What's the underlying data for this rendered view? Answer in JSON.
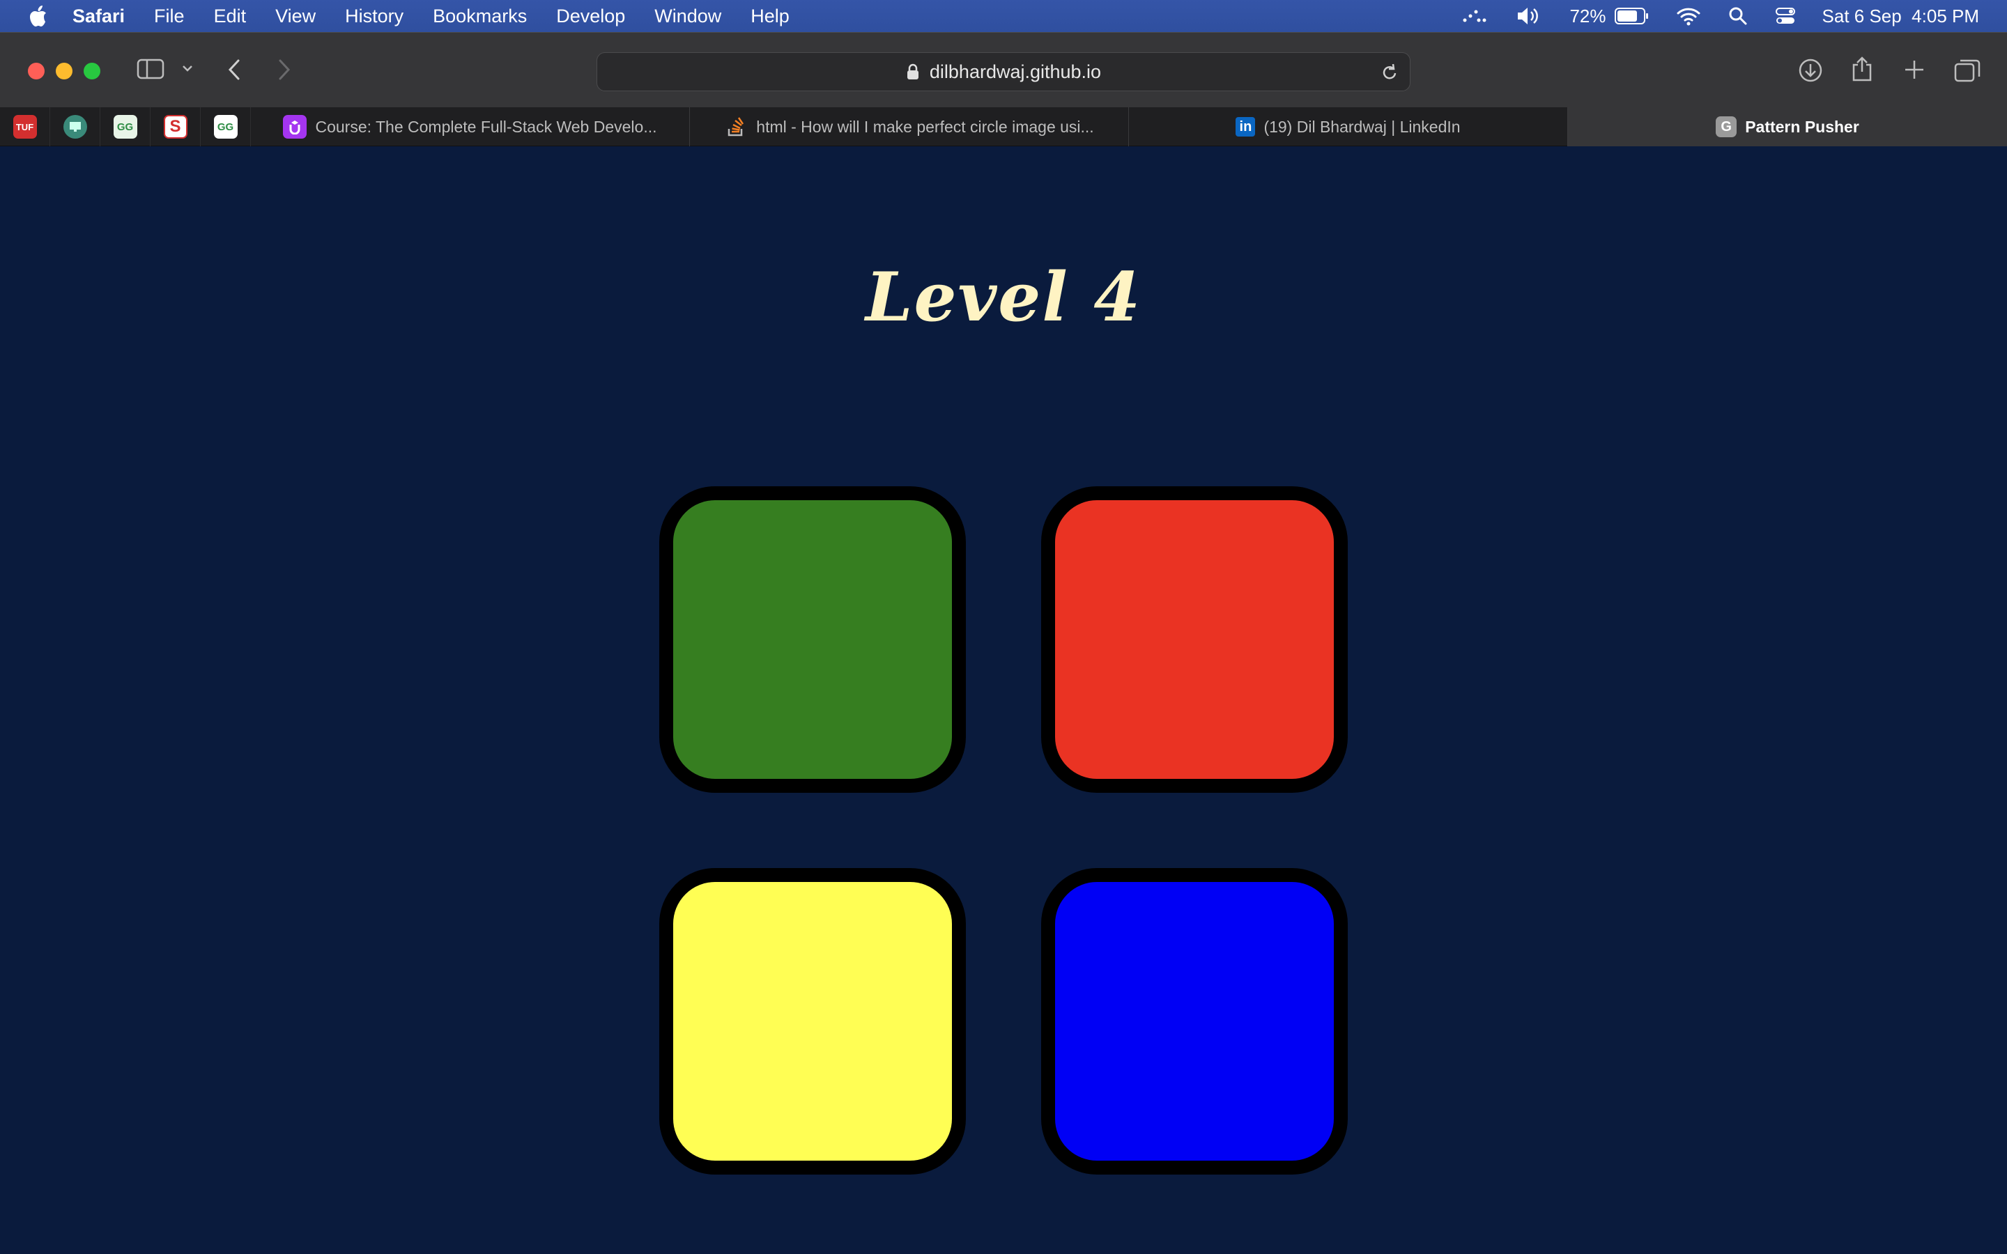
{
  "menubar": {
    "app": "Safari",
    "items": [
      "File",
      "Edit",
      "View",
      "History",
      "Bookmarks",
      "Develop",
      "Window",
      "Help"
    ],
    "battery": "72%",
    "date": "Sat 6 Sep",
    "time": "4:05 PM"
  },
  "browser": {
    "url": "dilbhardwaj.github.io",
    "pinned_tabs": [
      {
        "icon": "tuf-favicon",
        "text": "TUF"
      },
      {
        "icon": "monitor-favicon",
        "text": ""
      },
      {
        "icon": "geeksforgeeks-favicon",
        "text": "GG"
      },
      {
        "icon": "s-favicon",
        "text": "S"
      },
      {
        "icon": "geeksforgeeks-favicon",
        "text": "GG"
      }
    ],
    "tabs": [
      {
        "title": "Course: The Complete Full-Stack Web Develo...",
        "icon": "udemy-favicon"
      },
      {
        "title": "html - How will I make perfect circle image usi...",
        "icon": "stackoverflow-favicon"
      },
      {
        "title": "(19) Dil Bhardwaj | LinkedIn",
        "icon": "linkedin-favicon"
      },
      {
        "title": "Pattern Pusher",
        "icon": "g-favicon",
        "active": true
      }
    ]
  },
  "game": {
    "title": "Level 4",
    "pads": [
      {
        "color_name": "green",
        "color": "#367e20"
      },
      {
        "color_name": "red",
        "color": "#ea3323"
      },
      {
        "color_name": "yellow",
        "color": "#fffe54"
      },
      {
        "color_name": "blue",
        "color": "#0000f5"
      }
    ]
  },
  "colors": {
    "page_background": "#0a1b3d",
    "title_color": "#fef3c3",
    "menubar": "#3253a6"
  }
}
